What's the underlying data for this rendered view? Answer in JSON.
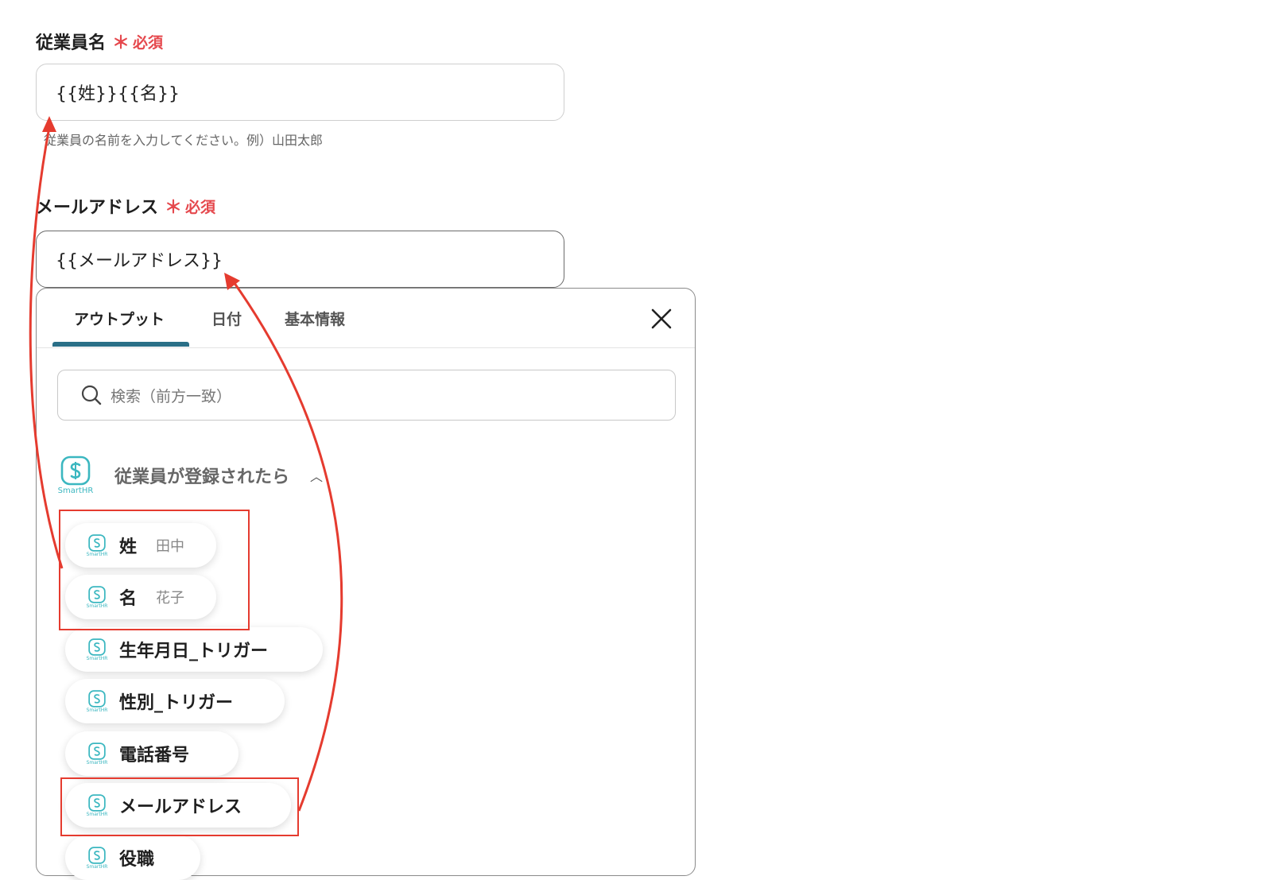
{
  "form": {
    "employee_name": {
      "label": "従業員名",
      "required": "必須",
      "value": "{{姓}}{{名}}",
      "hint": "従業員の名前を入力してください。例）山田太郎"
    },
    "email": {
      "label": "メールアドレス",
      "required": "必須",
      "value": "{{メールアドレス}}"
    }
  },
  "panel": {
    "tabs": [
      {
        "label": "アウトプット",
        "active": true
      },
      {
        "label": "日付",
        "active": false
      },
      {
        "label": "基本情報",
        "active": false
      }
    ],
    "search_placeholder": "検索（前方一致）",
    "group": {
      "app_label": "SmartHR",
      "title": "従業員が登録されたら",
      "items": [
        {
          "name": "姓",
          "value": "田中"
        },
        {
          "name": "名",
          "value": "花子"
        },
        {
          "name": "生年月日_トリガー",
          "value": ""
        },
        {
          "name": "性別_トリガー",
          "value": ""
        },
        {
          "name": "電話番号",
          "value": ""
        },
        {
          "name": "メールアドレス",
          "value": ""
        },
        {
          "name": "役職",
          "value": ""
        }
      ]
    }
  },
  "colors": {
    "required": "#e5484d",
    "tab_underline": "#2a6f87",
    "annotation": "#e53b2f",
    "smarthr_teal": "#3bb7c0"
  },
  "icons": [
    "search-icon",
    "close-icon",
    "smarthr-logo-icon",
    "chevron-up-icon"
  ]
}
